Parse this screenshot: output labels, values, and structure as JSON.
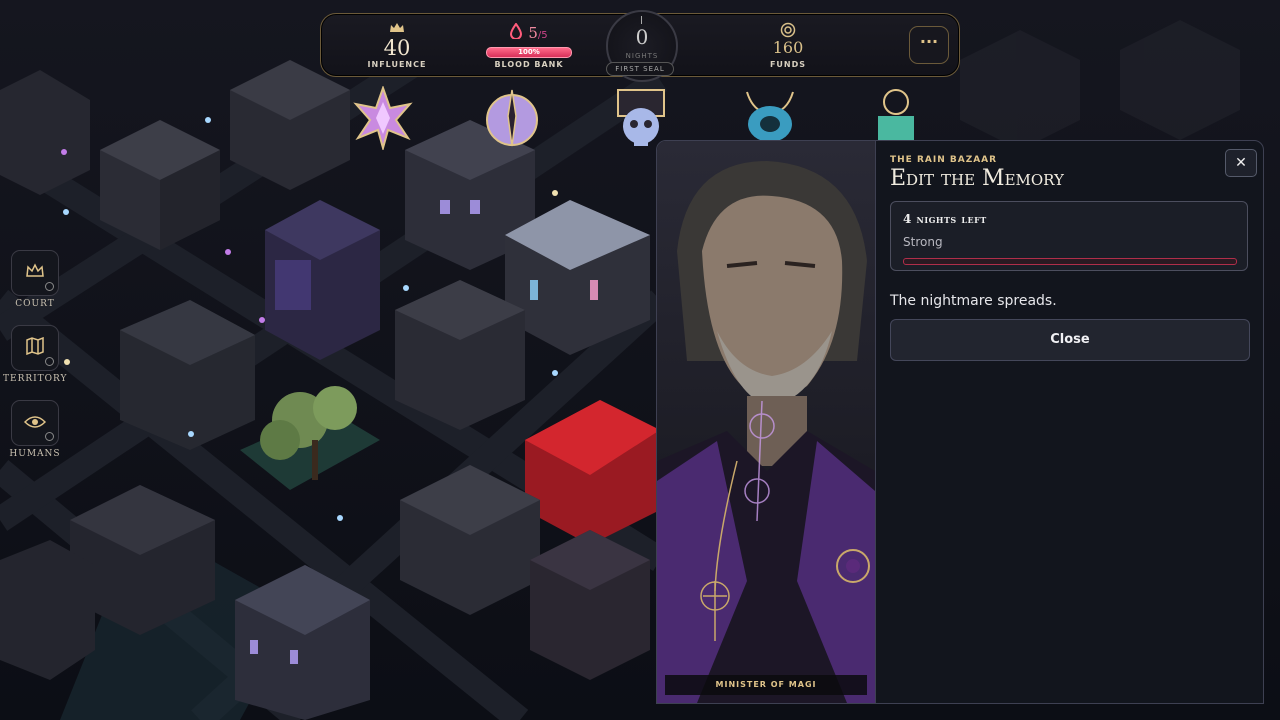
{
  "resources": {
    "influence": {
      "value": "40",
      "label": "INFLUENCE"
    },
    "blood_bank": {
      "value": "5",
      "max": "/5",
      "percent": "100%",
      "label": "BLOOD BANK"
    },
    "nights": {
      "value": "0",
      "label": "NIGHTS",
      "seal": "FIRST SEAL"
    },
    "funds": {
      "value": "160",
      "label": "FUNDS"
    },
    "menu_label": "···"
  },
  "factions": [
    "star-crest-emblem",
    "moon-dagger-emblem",
    "skull-tower-emblem",
    "eye-horn-emblem",
    "fist-gear-emblem"
  ],
  "nav": {
    "court": "COURT",
    "territory": "TERRITORY",
    "humans": "HUMANS"
  },
  "dialog": {
    "location": "THE RAIN BAZAAR",
    "title": "Edit the Memory",
    "status": {
      "nights_left": "4 nights left",
      "strength": "Strong",
      "progress": 1.0
    },
    "description": "The nightmare spreads.",
    "close_button": "Close",
    "x_button": "✕",
    "portrait_caption": "MINISTER OF MAGI"
  },
  "colors": {
    "accent_gold": "#e0c48a",
    "blood": "#d8305a",
    "panel": "#12151d"
  }
}
